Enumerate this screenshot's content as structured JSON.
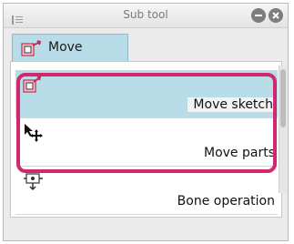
{
  "window": {
    "title": "Sub tool",
    "icons": {
      "grip": "grip-lines-icon",
      "minimize": "minimize-icon",
      "close": "close-icon"
    }
  },
  "tab": {
    "label": "Move",
    "icon": "move-tool-icon",
    "active": true
  },
  "tools": [
    {
      "label": "Move sketch",
      "icon": "move-sketch-icon",
      "selected": true
    },
    {
      "label": "Move parts",
      "icon": "move-parts-icon",
      "selected": false
    },
    {
      "label": "Bone operation",
      "icon": "bone-operation-icon",
      "selected": false
    }
  ],
  "colors": {
    "selection": "#b8dde9",
    "highlight_outline": "#d0286e"
  }
}
